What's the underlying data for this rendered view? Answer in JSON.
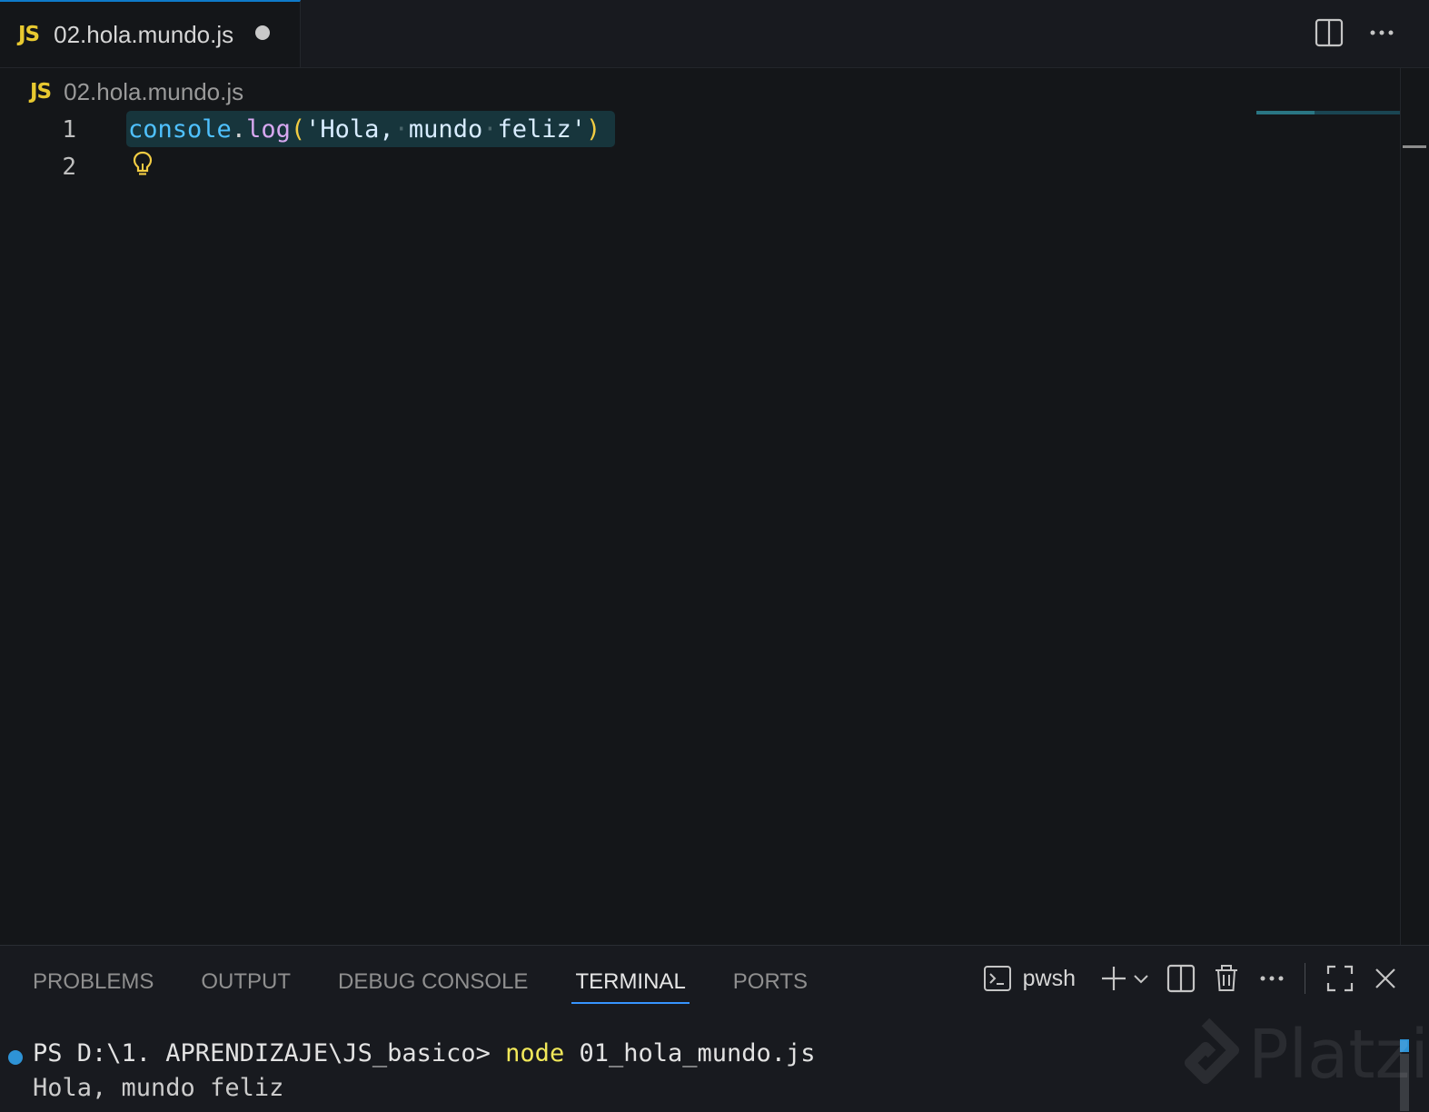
{
  "editor_tab": {
    "lang_badge": "JS",
    "title": "02.hola.mundo.js",
    "dirty": true
  },
  "breadcrumb": {
    "lang_badge": "JS",
    "file": "02.hola.mundo.js"
  },
  "code": {
    "lines": [
      {
        "number": "1",
        "tokens": {
          "obj": "console",
          "dot": ".",
          "fn": "log",
          "open": "(",
          "str1": "'Hola,",
          "str2": "mundo",
          "str3": "feliz'",
          "close": ")"
        }
      },
      {
        "number": "2"
      }
    ]
  },
  "panel": {
    "tabs": [
      "PROBLEMS",
      "OUTPUT",
      "DEBUG CONSOLE",
      "TERMINAL",
      "PORTS"
    ],
    "active_tab": "TERMINAL",
    "shell": "pwsh"
  },
  "terminal": {
    "prompt": "PS D:\\1. APRENDIZAJE\\JS_basico> ",
    "command": "node",
    "argument": " 01_hola_mundo.js",
    "output": "Hola, mundo feliz"
  },
  "watermark": "Platzi",
  "colors": {
    "accent": "#0e7aca",
    "js_badge": "#e8c930",
    "terminal_dot": "#2e93d6"
  },
  "icons": [
    "split-editor-icon",
    "more-actions-icon",
    "lightbulb-icon",
    "terminal-icon",
    "plus-icon",
    "chevron-down-icon",
    "split-terminal-icon",
    "trash-icon",
    "maximize-icon",
    "close-icon"
  ]
}
